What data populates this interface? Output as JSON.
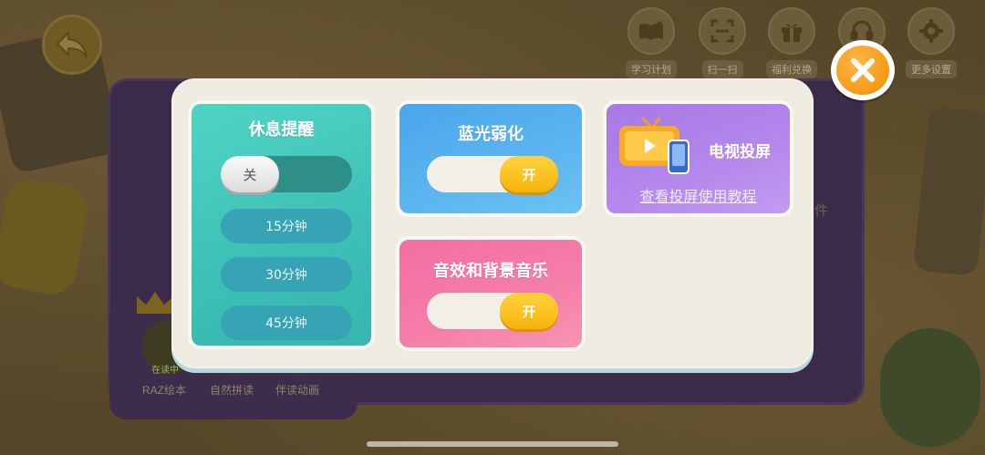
{
  "background": {
    "thumb_labels": [
      "RAZ绘本",
      "自然拼读",
      "伴读动画"
    ],
    "thumb_badge": "在读中",
    "side_text": "件"
  },
  "toolbar": {
    "items": [
      {
        "label": "学习计划",
        "icon": "book-pen-icon"
      },
      {
        "label": "扫一扫",
        "icon": "scan-icon"
      },
      {
        "label": "福利兑换",
        "icon": "gift-icon"
      },
      {
        "label": "",
        "icon": "headset-icon"
      },
      {
        "label": "更多设置",
        "icon": "gear-icon"
      }
    ]
  },
  "rest_reminder": {
    "title": "休息提醒",
    "toggle_label": "关",
    "options": [
      "15分钟",
      "30分钟",
      "45分钟"
    ]
  },
  "blue_light": {
    "title": "蓝光弱化",
    "toggle_label": "开"
  },
  "tv_cast": {
    "title": "电视投屏",
    "link": "查看投屏使用教程"
  },
  "sound": {
    "title": "音效和背景音乐",
    "toggle_label": "开"
  },
  "colors": {
    "close_orange": "#f59a16",
    "toggle_on_yellow": "#f5b40a",
    "rest_teal": "#3cc0b6",
    "blue": "#5cb5f0",
    "purple": "#b488ec",
    "pink": "#f57ea9"
  }
}
